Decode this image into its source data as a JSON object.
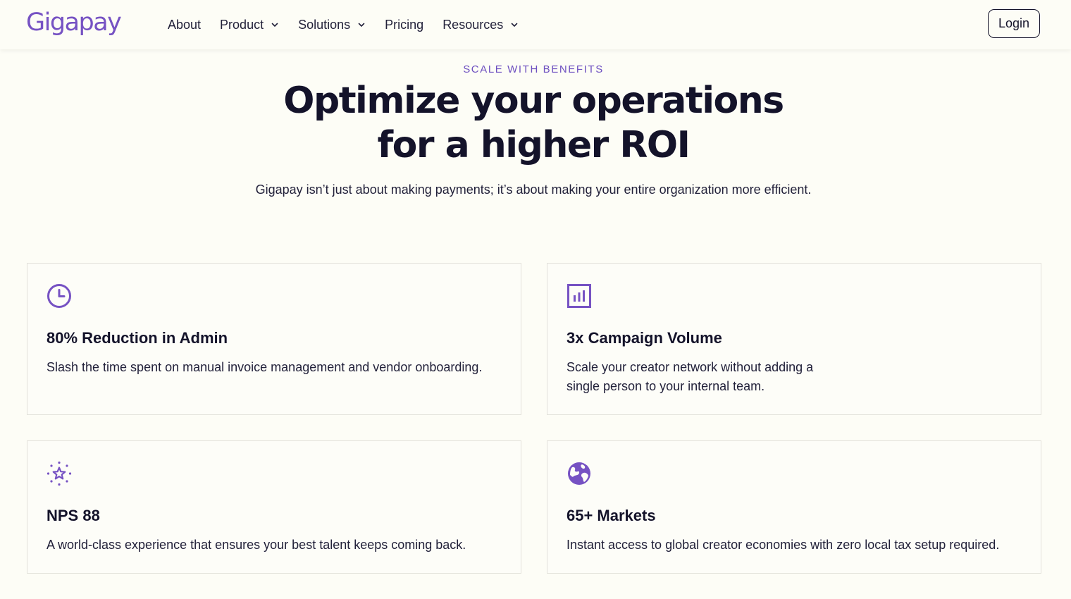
{
  "brand": {
    "name": "Gigapay",
    "accent": "#7652c3"
  },
  "nav": {
    "items": [
      {
        "label": "About",
        "dropdown": false
      },
      {
        "label": "Product",
        "dropdown": true
      },
      {
        "label": "Solutions",
        "dropdown": true
      },
      {
        "label": "Pricing",
        "dropdown": false
      },
      {
        "label": "Resources",
        "dropdown": true
      }
    ],
    "login_label": "Login"
  },
  "hero": {
    "eyebrow": "SCALE WITH BENEFITS",
    "headline_line1": "Optimize your operations",
    "headline_line2": "for a higher ROI",
    "subhead": "Gigapay isn’t just about making payments; it’s about making your entire organization more efficient."
  },
  "cards": [
    {
      "icon": "clock-icon",
      "title": "80% Reduction in Admin",
      "description": "Slash the time spent on manual invoice management and vendor onboarding."
    },
    {
      "icon": "bar-chart-icon",
      "title": "3x Campaign Volume",
      "description": "Scale your creator network without adding a single person to your internal team."
    },
    {
      "icon": "star-sparkle-icon",
      "title": "NPS 88",
      "description": "A world-class experience that ensures your best talent keeps coming back."
    },
    {
      "icon": "globe-icon",
      "title": "65+ Markets",
      "description": "Instant access to global creator economies with zero local tax setup required."
    }
  ]
}
